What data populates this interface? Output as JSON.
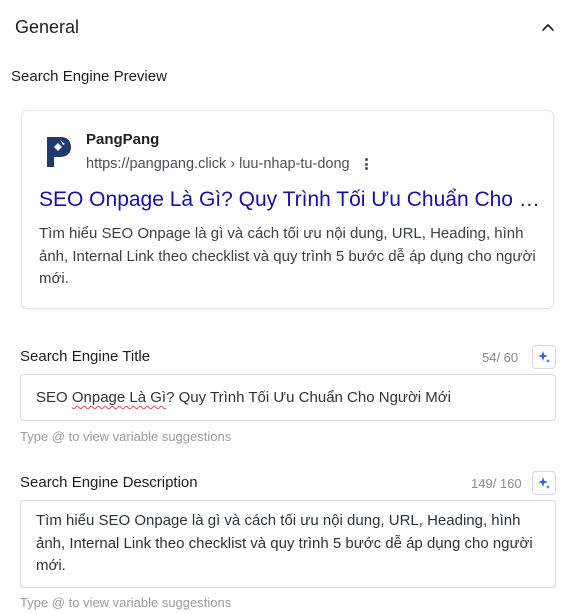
{
  "section": {
    "title": "General"
  },
  "preview": {
    "label": "Search Engine Preview",
    "site_name": "PangPang",
    "site_url": "https://pangpang.click › luu-nhap-tu-dong",
    "title": "SEO Onpage Là Gì? Quy Trình Tối Ưu Chuẩn Cho Người Mới",
    "description": "Tìm hiểu SEO Onpage là gì và cách tối ưu nội dung, URL, Heading, hình ảnh, Internal Link theo checklist và quy trình 5 bước dễ áp dụng cho người mới.",
    "title_color": "#1a0dab"
  },
  "title_field": {
    "label": "Search Engine Title",
    "counter": "54/ 60",
    "value_misspelled_part": "Onpage Là Gì",
    "value_prefix": "SEO ",
    "value_suffix": "? Quy Trình Tối Ưu Chuẩn Cho Người Mới",
    "hint": "Type @ to view variable suggestions"
  },
  "description_field": {
    "label": "Search Engine Description",
    "counter": "149/ 160",
    "value": "Tìm hiểu SEO Onpage là gì và cách tối ưu nội dung, URL, Heading, hình ảnh, Internal Link theo checklist và quy trình 5 bước dễ áp dụng cho người mới.",
    "hint": "Type @ to view variable suggestions"
  },
  "icons": {
    "collapse": "chevron-up-icon",
    "logo": "pangpang-logo",
    "more": "kebab-menu-icon",
    "ai": "sparkle-icon"
  },
  "colors": {
    "accent": "#3858e9",
    "link": "#1a0dab",
    "logo": "#1f3a6e"
  }
}
